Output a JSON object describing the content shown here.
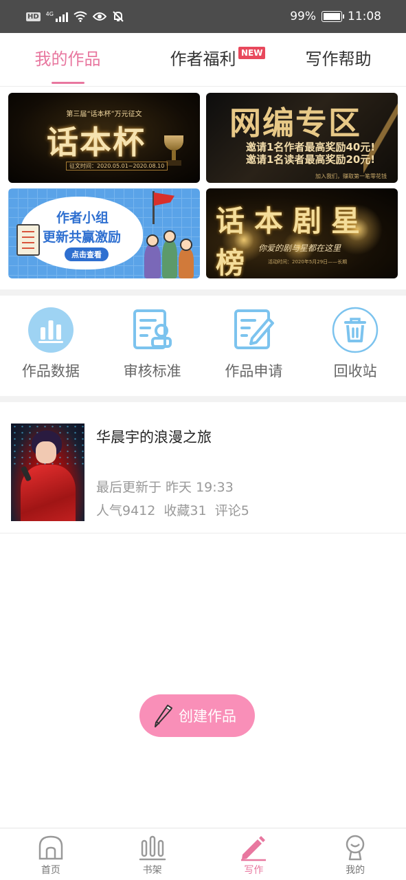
{
  "status_bar": {
    "hd": "HD",
    "network": "4G",
    "battery_percent": "99%",
    "time": "11:08"
  },
  "tabs": [
    {
      "label": "我的作品",
      "active": true
    },
    {
      "label": "作者福利",
      "badge": "NEW",
      "active": false
    },
    {
      "label": "写作帮助",
      "active": false
    }
  ],
  "banners": {
    "banner1": {
      "subtitle": "第三届“话本杯”万元征文",
      "title": "话本杯",
      "date": "征文时间：2020.05.01~2020.08.10"
    },
    "banner2": {
      "title": "网编专区",
      "line1": "邀请1名作者最高奖励40元!",
      "line2": "邀请1名读者最高奖励20元!",
      "footer": "加入我们，赚取第一笔零花钱"
    },
    "banner3": {
      "line1": "作者小组",
      "line2": "更新共赢激励",
      "button": "点击查看"
    },
    "banner4": {
      "title": "话本剧星榜",
      "subtitle": "你爱的剧与星都在这里",
      "footer": "活动时间：2020年5月29日——长期"
    }
  },
  "actions": [
    {
      "label": "作品数据",
      "icon": "bar-chart-icon"
    },
    {
      "label": "审核标准",
      "icon": "review-standard-icon"
    },
    {
      "label": "作品申请",
      "icon": "edit-document-icon"
    },
    {
      "label": "回收站",
      "icon": "trash-icon"
    }
  ],
  "work": {
    "title": "华晨宇的浪漫之旅",
    "updated": "最后更新于 昨天 19:33",
    "stats": "人气9412  收藏31  评论5"
  },
  "create_button": "创建作品",
  "bottom_nav": [
    {
      "label": "首页",
      "icon": "home-icon",
      "active": false
    },
    {
      "label": "书架",
      "icon": "bookshelf-icon",
      "active": false
    },
    {
      "label": "写作",
      "icon": "pencil-icon",
      "active": true
    },
    {
      "label": "我的",
      "icon": "profile-icon",
      "active": false
    }
  ],
  "colors": {
    "accent": "#e8779f",
    "create_button": "#f98fb8",
    "action_icon": "#7cc3ee",
    "badge_new": "#e8485c"
  }
}
